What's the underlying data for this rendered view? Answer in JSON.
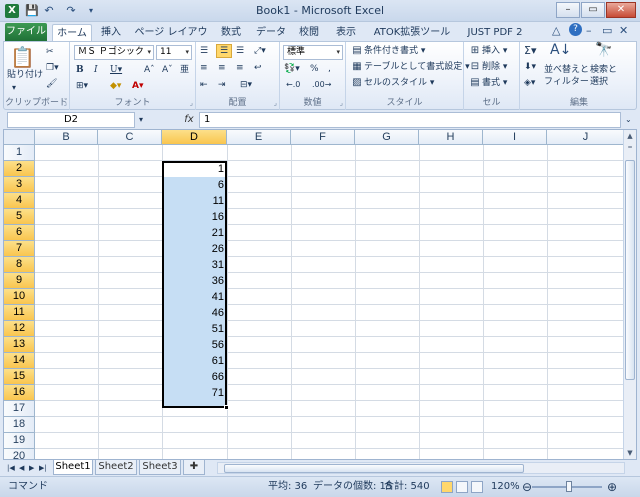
{
  "window": {
    "title": "Book1 - Microsoft Excel",
    "controls": [
      "–",
      "▭",
      "✕"
    ]
  },
  "tabs": {
    "file": "ファイル",
    "items": [
      "ホーム",
      "挿入",
      "ページ レイアウト",
      "数式",
      "データ",
      "校閲",
      "表示",
      "ATOK拡張ツール",
      "JUST PDF 2"
    ]
  },
  "ribbon": {
    "clipboard": {
      "paste": "貼り付け",
      "label": "クリップボード"
    },
    "font": {
      "name": "ＭＳ Ｐゴシック",
      "size": "11",
      "label": "フォント"
    },
    "alignment": {
      "label": "配置"
    },
    "number": {
      "format": "標準",
      "label": "数値"
    },
    "styles": {
      "conditional": "条件付き書式",
      "table": "テーブルとして書式設定",
      "cell": "セルのスタイル",
      "label": "スタイル"
    },
    "cells": {
      "insert": "挿入",
      "delete": "削除",
      "format": "書式",
      "label": "セル"
    },
    "editing": {
      "sort": "並べ替えと",
      "sort2": "フィルター",
      "find": "検索と",
      "find2": "選択",
      "label": "編集"
    }
  },
  "formula_bar": {
    "name_box": "D2",
    "fx": "fx",
    "value": "1"
  },
  "grid": {
    "columns": [
      "B",
      "C",
      "D",
      "E",
      "F",
      "G",
      "H",
      "I",
      "J"
    ],
    "rows": [
      "1",
      "2",
      "3",
      "4",
      "5",
      "6",
      "7",
      "8",
      "9",
      "10",
      "11",
      "12",
      "13",
      "14",
      "15",
      "16",
      "17",
      "18",
      "19",
      "20"
    ],
    "selected_column": "D",
    "d_values": [
      "1",
      "6",
      "11",
      "16",
      "21",
      "26",
      "31",
      "36",
      "41",
      "46",
      "51",
      "56",
      "61",
      "66",
      "71"
    ]
  },
  "sheets": [
    "Sheet1",
    "Sheet2",
    "Sheet3"
  ],
  "status": {
    "mode": "コマンド",
    "average": "平均: 36",
    "count": "データの個数: 15",
    "sum": "合計: 540",
    "zoom": "120%"
  }
}
